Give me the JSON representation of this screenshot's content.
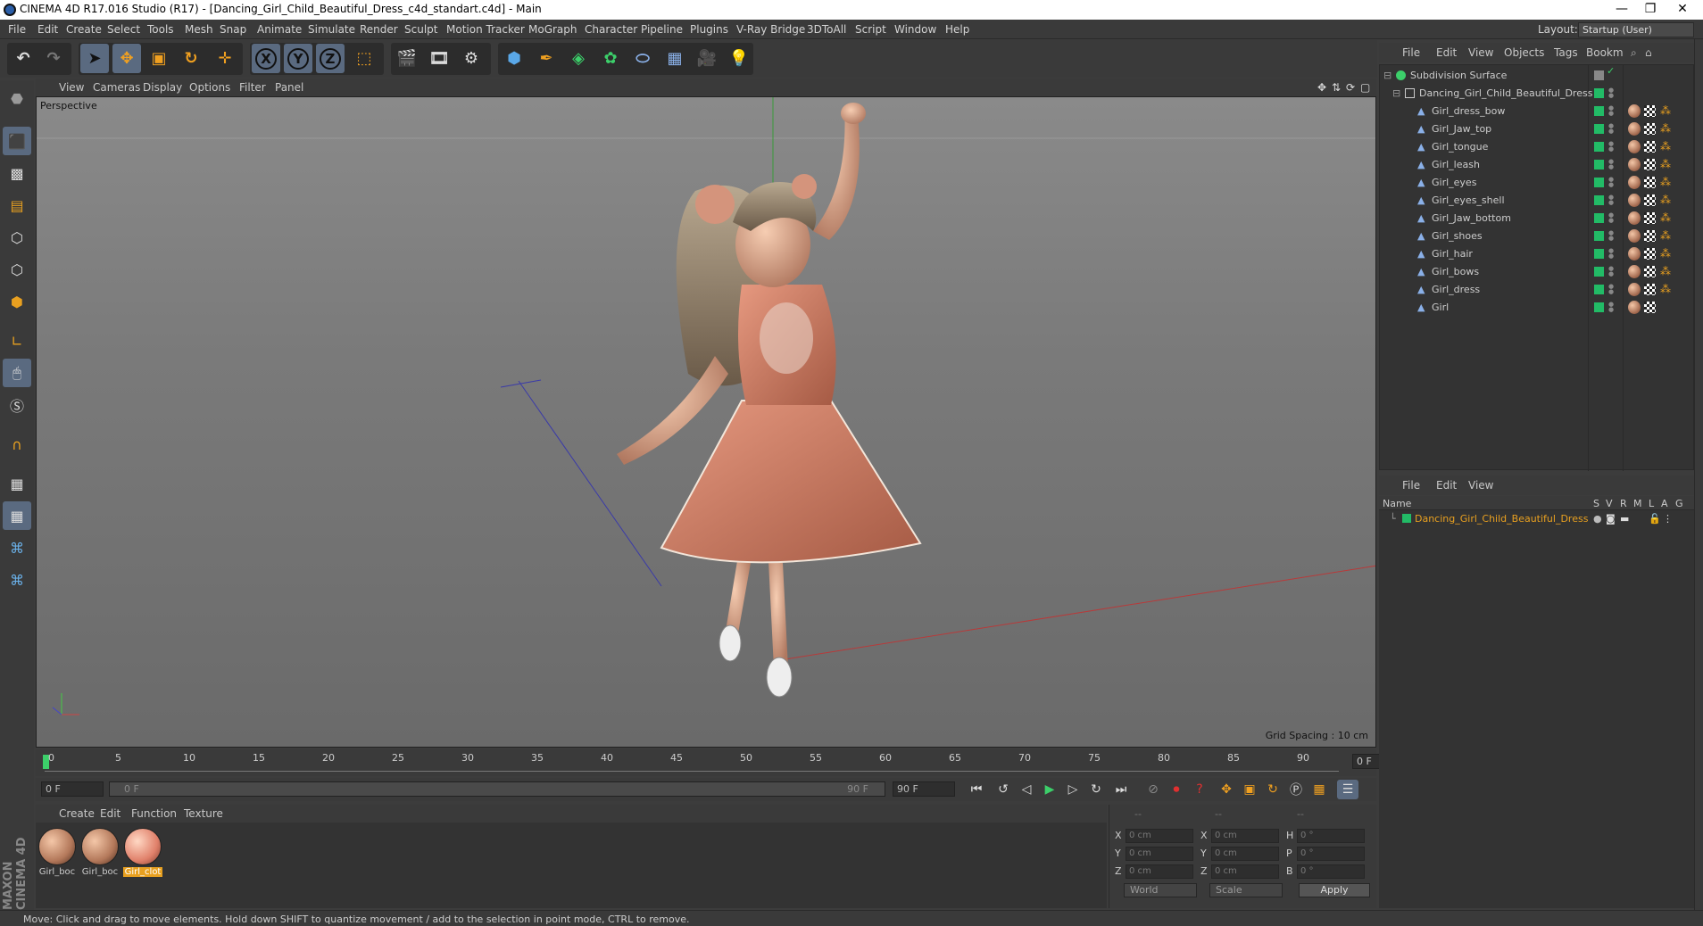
{
  "window": {
    "title": "CINEMA 4D R17.016 Studio (R17) - [Dancing_Girl_Child_Beautiful_Dress_c4d_standart.c4d] - Main",
    "minimize": "—",
    "restore": "❐",
    "close": "✕"
  },
  "menubar": {
    "items": [
      "File",
      "Edit",
      "Create",
      "Select",
      "Tools",
      "Mesh",
      "Snap",
      "Animate",
      "Simulate",
      "Render",
      "Sculpt",
      "Motion Tracker",
      "MoGraph",
      "Character",
      "Pipeline",
      "Plugins",
      "V-Ray Bridge",
      "3DToAll",
      "Script",
      "Window",
      "Help"
    ],
    "layout_label": "Layout:",
    "layout_value": "Startup (User)"
  },
  "toolbar": {
    "axis_x": "X",
    "axis_y": "Y",
    "axis_z": "Z"
  },
  "viewport": {
    "menu": [
      "View",
      "Cameras",
      "Display",
      "Options",
      "Filter",
      "Panel"
    ],
    "camera_label": "Perspective",
    "grid_spacing": "Grid Spacing : 10 cm"
  },
  "timeline": {
    "ticks": [
      "0",
      "5",
      "10",
      "15",
      "20",
      "25",
      "30",
      "35",
      "40",
      "45",
      "50",
      "55",
      "60",
      "65",
      "70",
      "75",
      "80",
      "85",
      "90"
    ],
    "current_frame": "0 F",
    "start_field": "0 F",
    "range_start": "0 F",
    "range_end": "90 F",
    "end_field": "90 F"
  },
  "materials": {
    "menu": [
      "Create",
      "Edit",
      "Function",
      "Texture"
    ],
    "items": [
      {
        "label": "Girl_boc",
        "selected": false
      },
      {
        "label": "Girl_boc",
        "selected": false
      },
      {
        "label": "Girl_clot",
        "selected": true
      }
    ]
  },
  "coordinates": {
    "headers": [
      "--",
      "--",
      "--"
    ],
    "rows": [
      {
        "l1": "X",
        "v1": "0 cm",
        "l2": "X",
        "v2": "0 cm",
        "l3": "H",
        "v3": "0 °"
      },
      {
        "l1": "Y",
        "v1": "0 cm",
        "l2": "Y",
        "v2": "0 cm",
        "l3": "P",
        "v3": "0 °"
      },
      {
        "l1": "Z",
        "v1": "0 cm",
        "l2": "Z",
        "v2": "0 cm",
        "l3": "B",
        "v3": "0 °"
      }
    ],
    "space": "World",
    "mode": "Scale",
    "apply": "Apply"
  },
  "object_manager": {
    "menu": [
      "File",
      "Edit",
      "View",
      "Objects",
      "Tags",
      "Bookm"
    ],
    "objects": [
      {
        "name": "Subdivision Surface",
        "level": 0
      },
      {
        "name": "Dancing_Girl_Child_Beautiful_Dress",
        "level": 1
      },
      {
        "name": "Girl_dress_bow",
        "level": 2
      },
      {
        "name": "Girl_Jaw_top",
        "level": 2
      },
      {
        "name": "Girl_tongue",
        "level": 2
      },
      {
        "name": "Girl_leash",
        "level": 2
      },
      {
        "name": "Girl_eyes",
        "level": 2
      },
      {
        "name": "Girl_eyes_shell",
        "level": 2
      },
      {
        "name": "Girl_Jaw_bottom",
        "level": 2
      },
      {
        "name": "Girl_shoes",
        "level": 2
      },
      {
        "name": "Girl_hair",
        "level": 2
      },
      {
        "name": "Girl_bows",
        "level": 2
      },
      {
        "name": "Girl_dress",
        "level": 2
      },
      {
        "name": "Girl",
        "level": 2
      }
    ]
  },
  "layer_manager": {
    "menu": [
      "File",
      "Edit",
      "View"
    ],
    "columns": [
      "Name",
      "S",
      "V",
      "R",
      "M",
      "L",
      "A",
      "G"
    ],
    "rows": [
      {
        "name": "Dancing_Girl_Child_Beautiful_Dress"
      }
    ]
  },
  "statusbar": {
    "message": "Move: Click and drag to move elements. Hold down SHIFT to quantize movement / add to the selection in point mode, CTRL to remove."
  },
  "branding": {
    "logo_text": "MAXON CINEMA 4D"
  },
  "colors": {
    "accent": "#e8a020",
    "visible_green": "#22bb66",
    "active_tool": "#5a6a80"
  }
}
